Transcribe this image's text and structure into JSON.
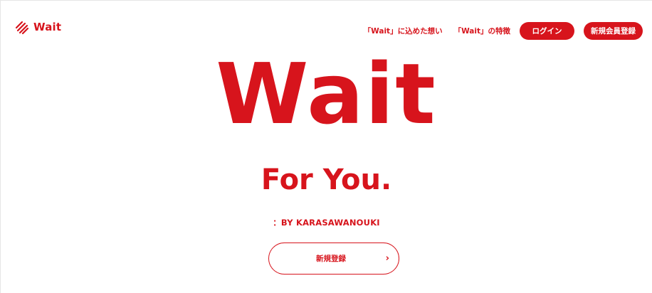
{
  "header": {
    "logo_text": "Wait",
    "nav": {
      "link_thoughts": "「Wait」に込めた想い",
      "link_features": "「Wait」の特徴",
      "login_label": "ログイン",
      "signup_label": "新規会員登録"
    }
  },
  "hero": {
    "title": "Wait",
    "subtitle": "For You.",
    "byline": "：BY KARASAWANOUKI",
    "cta_label": "新規登録",
    "cta_arrow": "›"
  },
  "colors": {
    "brand_red": "#d7141c",
    "background": "#ffffff"
  },
  "icons": {
    "logo": "layered-stripes-logo-icon",
    "cta_arrow": "chevron-right-icon"
  }
}
